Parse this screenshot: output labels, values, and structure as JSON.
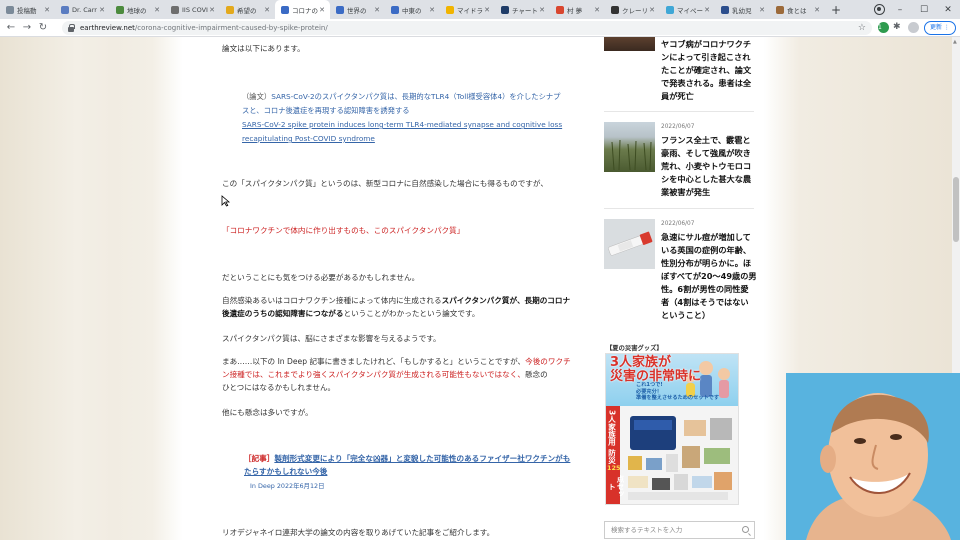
{
  "browser": {
    "tabs": [
      {
        "label": "投稿動",
        "color": "#7b8a99"
      },
      {
        "label": "Dr. Carr",
        "color": "#5a7cc1"
      },
      {
        "label": "地球の",
        "color": "#4c8b3e"
      },
      {
        "label": "IIS COVI",
        "color": "#6e6e6e"
      },
      {
        "label": "希望の",
        "color": "#e3a91c"
      },
      {
        "label": "コロナの",
        "color": "#3b6bc5",
        "active": true
      },
      {
        "label": "世界の",
        "color": "#3b6bc5"
      },
      {
        "label": "中東の",
        "color": "#3b6bc5"
      },
      {
        "label": "マイドラ",
        "color": "#f1b400"
      },
      {
        "label": "チャート",
        "color": "#1f3c68"
      },
      {
        "label": "村 夢",
        "color": "#d9462f"
      },
      {
        "label": "クレーリ",
        "color": "#333333"
      },
      {
        "label": "マイペー",
        "color": "#3fa7d6"
      },
      {
        "label": "乳幼児",
        "color": "#2c4e8d"
      },
      {
        "label": "食とは",
        "color": "#9c6a3a"
      }
    ],
    "new_tab": "+",
    "window_controls": [
      "–",
      "☐",
      "✕"
    ],
    "nav": {
      "back": "←",
      "forward": "→",
      "reload": "↻"
    },
    "url_host": "earthreview.net",
    "url_path": "/corona-cognitive-impairment-caused-by-spike-protein/",
    "star": "☆",
    "ext_badge": "1",
    "puzzle": "✱",
    "update_label": "更新 ⋮",
    "menu": "⋮"
  },
  "article": {
    "intro": "論文は以下にあります。",
    "quote_label": "（論文）",
    "quote_jp_1": "SARS-CoV-2のスパイクタンパク質は、長期的なTLR4（Toll様受容体4）を介したシナプ",
    "quote_jp_2": "スと、コロナ後遺症を再現する認知障害を誘発する",
    "quote_en_1": "SARS-CoV-2 spike protein induces long-term TLR4-mediated synapse and cognitive loss",
    "quote_en_2": "recapitulating Post-COVID syndrome",
    "p1": "この「スパイクタンパク質」というのは、新型コロナに自然感染した場合にも得るものですが、",
    "red_quote": "「コロナワクチンで体内に作り出すものも、このスパイクタンパク質」",
    "p2": "だということにも気をつける必要があるかもしれません。",
    "p3_a": "自然感染あるいはコロナワクチン接種によって体内に生成される",
    "p3_b": "スパイクタンパク質が、長期のコロナ",
    "p3_c": "後遺症のうちの認知障害につながる",
    "p3_d": "ということがわかったという論文です。",
    "p4": "スパイクタンパク質は、脳にさまざまな影響を与えるようです。",
    "p5_a": "まあ……以下の In Deep 記事に書きましたけれど、「もしかすると」ということですが、",
    "p5_b": "今後のワクチ",
    "p5_c": "ン接種では、これまでより強くスパイクタンパク質が生成される可能性もないではなく、",
    "p5_d": "懸念の",
    "p5_e": "ひとつにはなるかもしれません。",
    "p6": "他にも懸念は多いですが。",
    "rel_label": "［記事］",
    "rel_title_1": "製剤形式変更により「完全な凶器」と変貌した可能性のあるファイザー社ワクチンがも",
    "rel_title_2": "たらすかもしれない今後",
    "rel_meta": "In Deep 2022年6月12日",
    "p7": "リオデジャネイロ連邦大学の論文の内容を取りあげていた記事をご紹介します。"
  },
  "sidebar": {
    "post0_title_1": "ヤコブ病がコロナワクチ",
    "post0_title_2": "ンによって引き起こされ",
    "post0_title_3": "たことが確定され、論文",
    "post0_title_4": "で発表される。患者は全",
    "post0_title_5": "員が死亡",
    "post1_date": "2022/06/07",
    "post1_title_1": "フランス全土で、霰雹と",
    "post1_title_2": "豪雨、そして強風が吹き",
    "post1_title_3": "荒れ、小麦やトウモロコ",
    "post1_title_4": "シを中心とした甚大な農",
    "post1_title_5": "業被害が発生",
    "post2_date": "2022/06/07",
    "post2_title_1": "急速にサル痘が増加して",
    "post2_title_2": "いる英国の症例の年齢、",
    "post2_title_3": "性別分布が明らかに。ほ",
    "post2_title_4": "ぼすべてが20〜49歳の男",
    "post2_title_5": "性。6割が男性の同性愛",
    "post2_title_6": "者（4割はそうではない",
    "post2_title_7": "ということ）",
    "ad_heading": "【夏の災害グッズ】",
    "ad_big_1": "3人家族が",
    "ad_big_2": "災害の非常時に",
    "ad_small_1": "これ1つで!",
    "ad_small_2": "必要充分！",
    "ad_small_3": "準備を整えさせるためのセットです",
    "ad_vertical_1": "3人家族用",
    "ad_vertical_2": "防災",
    "ad_vertical_3": "125",
    "ad_vertical_4": "点セット",
    "search_placeholder": "検索するテキストを入力"
  }
}
